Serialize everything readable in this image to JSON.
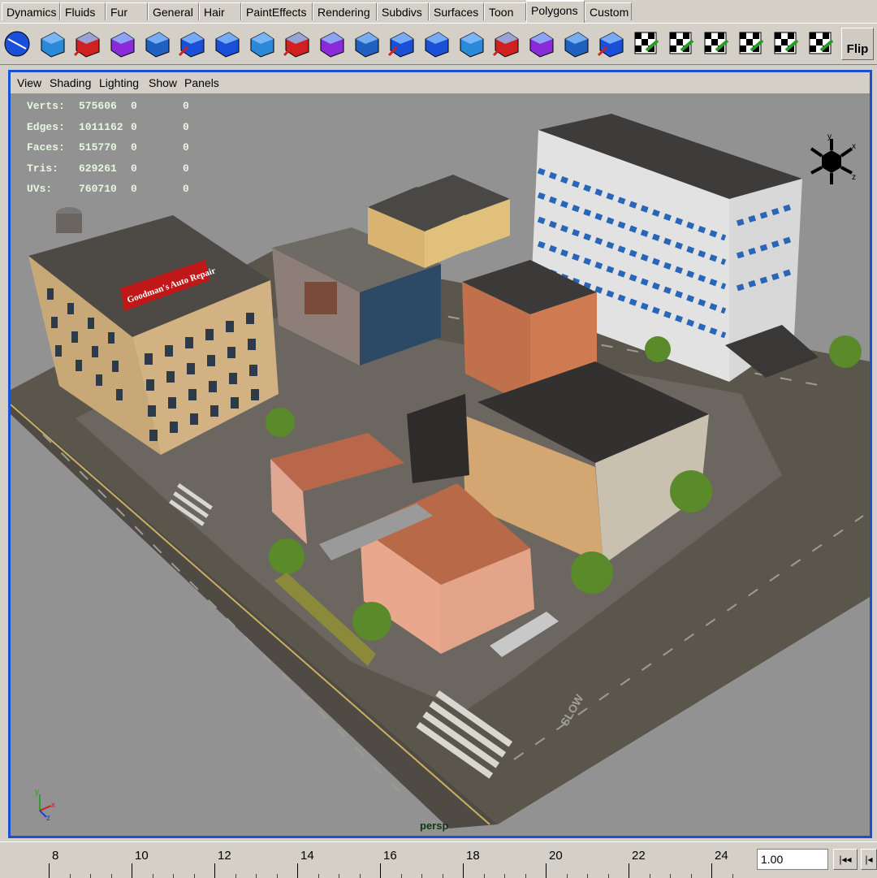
{
  "shelf_tabs": [
    "Dynamics",
    "Fluids",
    "Fur",
    "General",
    "Hair",
    "PaintEffects",
    "Rendering",
    "Subdivs",
    "Surfaces",
    "Toon",
    "Polygons",
    "Custom"
  ],
  "active_tab": "Polygons",
  "shelf_buttons": [
    "poly-sphere",
    "poly-cube",
    "poly-cylinder",
    "create-polygon-tool",
    "extrude-face",
    "split-polygon",
    "merge-vertices",
    "extrude-edge",
    "bevel",
    "append-polygon",
    "sculpt",
    "smooth",
    "triangulate",
    "quadrangulate",
    "subdivide",
    "planar-mapping",
    "cylindrical-mapping",
    "spherical-mapping",
    "uv-texture-editor",
    "automatic-mapping",
    "move-uvs",
    "layout-uvs",
    "unfold-uvs",
    "cut-uvs"
  ],
  "flip_label": "Flip",
  "viewport_menu": [
    "View",
    "Shading",
    "Lighting",
    "Show",
    "Panels"
  ],
  "hud_stats": [
    {
      "label": "Verts:",
      "value": "575606",
      "sel": "0",
      "sel2": "0"
    },
    {
      "label": "Edges:",
      "value": "1011162",
      "sel": "0",
      "sel2": "0"
    },
    {
      "label": "Faces:",
      "value": "515770",
      "sel": "0",
      "sel2": "0"
    },
    {
      "label": "Tris:",
      "value": "629261",
      "sel": "0",
      "sel2": "0"
    },
    {
      "label": "UVs:",
      "value": "760710",
      "sel": "0",
      "sel2": "0"
    }
  ],
  "camera_label": "persp",
  "view_cube_axes": [
    "y",
    "x",
    "z"
  ],
  "corner_axes": [
    "y",
    "x",
    "z"
  ],
  "sign_text": "Goodman's Auto Repair",
  "timeline_ticks": [
    "8",
    "10",
    "12",
    "14",
    "16",
    "18",
    "20",
    "22",
    "24"
  ],
  "current_frame": "1.00",
  "playback_buttons": [
    "step-back",
    "go-to-start"
  ],
  "colors": {
    "viewport_border": "#1a4fd8",
    "ui_gray": "#d4d0c8",
    "hud_text": "#e6f7e0"
  }
}
